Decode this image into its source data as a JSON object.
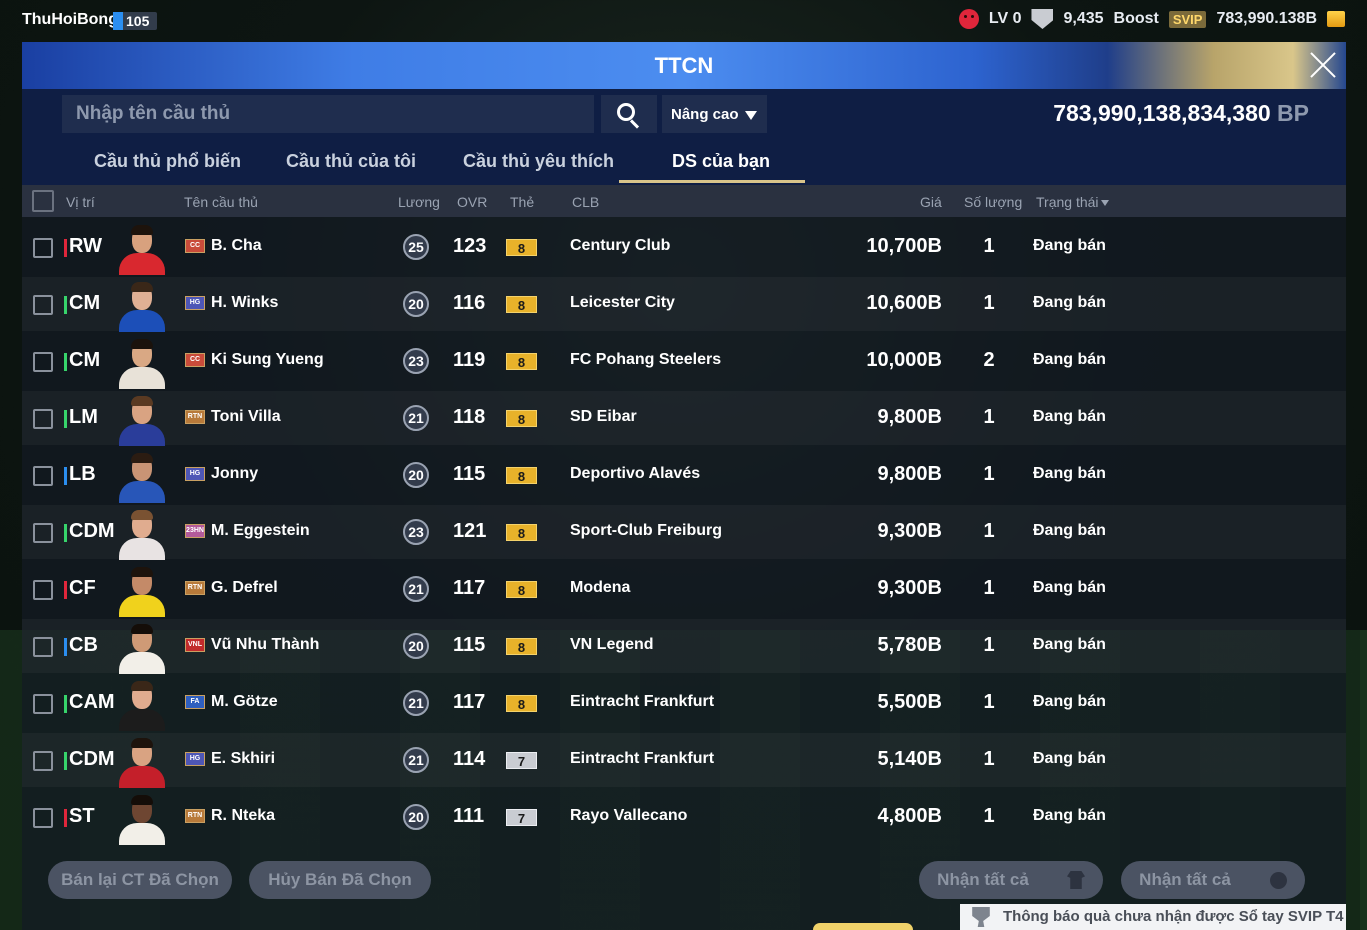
{
  "topbar": {
    "username": "ThuHoiBong",
    "level": "105",
    "lv": "LV 0",
    "coins": "9,435",
    "boost_label": "Boost",
    "svip_label": "SVIP",
    "balance_short": "783,990.138B"
  },
  "window": {
    "title": "TTCN"
  },
  "search": {
    "placeholder": "Nhập tên cầu thủ",
    "advanced_label": "Nâng cao",
    "balance": "783,990,138,834,380",
    "balance_unit": "BP"
  },
  "tabs": [
    {
      "label": "Cầu thủ phổ biến"
    },
    {
      "label": "Cầu thủ của tôi"
    },
    {
      "label": "Cầu thủ yêu thích"
    },
    {
      "label": "DS của bạn"
    }
  ],
  "columns": {
    "position": "Vị trí",
    "name": "Tên cầu thủ",
    "wage": "Lương",
    "ovr": "OVR",
    "card": "Thẻ",
    "club": "CLB",
    "price": "Giá",
    "quantity": "Số lượng",
    "status": "Trạng thái"
  },
  "colors": {
    "pos_attacker": "#e0263b",
    "pos_midfielder": "#37d46b",
    "pos_defender": "#2b8ef0",
    "tab_underline": "#d9c48a",
    "card_gold": "#e8b22a"
  },
  "players": [
    {
      "pos": "RW",
      "pos_color": "#e0263b",
      "season": "CC",
      "season_color": "#c94b3a",
      "name": "B. Cha",
      "wage": "25",
      "ovr": "123",
      "card": "8",
      "card_type": "gold",
      "club": "Century Club",
      "price": "10,700B",
      "qty": "1",
      "status": "Đang bán",
      "shirt": "#d9282f",
      "skin": "#d8a17e",
      "hair": "#1d130c"
    },
    {
      "pos": "CM",
      "pos_color": "#37d46b",
      "season": "HG",
      "season_color": "#4e56b6",
      "name": "H. Winks",
      "wage": "20",
      "ovr": "116",
      "card": "8",
      "card_type": "gold",
      "club": "Leicester City",
      "price": "10,600B",
      "qty": "1",
      "status": "Đang bán",
      "shirt": "#1c4fb8",
      "skin": "#e0b094",
      "hair": "#3a2718"
    },
    {
      "pos": "CM",
      "pos_color": "#37d46b",
      "season": "CC",
      "season_color": "#c94b3a",
      "name": "Ki Sung Yueng",
      "wage": "23",
      "ovr": "119",
      "card": "8",
      "card_type": "gold",
      "club": "FC Pohang Steelers",
      "price": "10,000B",
      "qty": "2",
      "status": "Đang bán",
      "shirt": "#e8e2d8",
      "skin": "#d9a884",
      "hair": "#1a120c"
    },
    {
      "pos": "LM",
      "pos_color": "#37d46b",
      "season": "RTN",
      "season_color": "#b87a3a",
      "name": "Toni Villa",
      "wage": "21",
      "ovr": "118",
      "card": "8",
      "card_type": "gold",
      "club": "SD Eibar",
      "price": "9,800B",
      "qty": "1",
      "status": "Đang bán",
      "shirt": "#2a3d9a",
      "skin": "#d9a382",
      "hair": "#5a3a22"
    },
    {
      "pos": "LB",
      "pos_color": "#2b8ef0",
      "season": "HG",
      "season_color": "#4e56b6",
      "name": "Jonny",
      "wage": "20",
      "ovr": "115",
      "card": "8",
      "card_type": "gold",
      "club": "Deportivo Alavés",
      "price": "9,800B",
      "qty": "1",
      "status": "Đang bán",
      "shirt": "#2856b8",
      "skin": "#c99475",
      "hair": "#2b1c12"
    },
    {
      "pos": "CDM",
      "pos_color": "#37d46b",
      "season": "23HN",
      "season_color": "#b35a9a",
      "name": "M. Eggestein",
      "wage": "23",
      "ovr": "121",
      "card": "8",
      "card_type": "gold",
      "club": "Sport-Club Freiburg",
      "price": "9,300B",
      "qty": "1",
      "status": "Đang bán",
      "shirt": "#e8e3e3",
      "skin": "#e0ac8f",
      "hair": "#7a5232"
    },
    {
      "pos": "CF",
      "pos_color": "#e0263b",
      "season": "RTN",
      "season_color": "#b87a3a",
      "name": "G. Defrel",
      "wage": "21",
      "ovr": "117",
      "card": "8",
      "card_type": "gold",
      "club": "Modena",
      "price": "9,300B",
      "qty": "1",
      "status": "Đang bán",
      "shirt": "#f0d21c",
      "skin": "#c48a68",
      "hair": "#1d130c"
    },
    {
      "pos": "CB",
      "pos_color": "#2b8ef0",
      "season": "VNL",
      "season_color": "#c22b2b",
      "name": "Vũ Nhu Thành",
      "wage": "20",
      "ovr": "115",
      "card": "8",
      "card_type": "gold",
      "club": "VN Legend",
      "price": "5,780B",
      "qty": "1",
      "status": "Đang bán",
      "shirt": "#f2efe8",
      "skin": "#cf9a76",
      "hair": "#140d08"
    },
    {
      "pos": "CAM",
      "pos_color": "#37d46b",
      "season": "FA",
      "season_color": "#2f5fbf",
      "name": "M. Götze",
      "wage": "21",
      "ovr": "117",
      "card": "8",
      "card_type": "gold",
      "club": "Eintracht Frankfurt",
      "price": "5,500B",
      "qty": "1",
      "status": "Đang bán",
      "shirt": "#1c1c1c",
      "skin": "#e0ac8f",
      "hair": "#3a2718"
    },
    {
      "pos": "CDM",
      "pos_color": "#37d46b",
      "season": "HG",
      "season_color": "#4e56b6",
      "name": "E. Skhiri",
      "wage": "21",
      "ovr": "114",
      "card": "7",
      "card_type": "silver",
      "club": "Eintracht Frankfurt",
      "price": "5,140B",
      "qty": "1",
      "status": "Đang bán",
      "shirt": "#c41f2a",
      "skin": "#d9a382",
      "hair": "#1d130c"
    },
    {
      "pos": "ST",
      "pos_color": "#e0263b",
      "season": "RTN",
      "season_color": "#b87a3a",
      "name": "R. Nteka",
      "wage": "20",
      "ovr": "111",
      "card": "7",
      "card_type": "silver",
      "club": "Rayo Vallecano",
      "price": "4,800B",
      "qty": "1",
      "status": "Đang bán",
      "shirt": "#f2efe8",
      "skin": "#6e4632",
      "hair": "#140d08"
    }
  ],
  "footer": {
    "resell_label": "Bán lại CT Đã Chọn",
    "cancel_label": "Hủy Bán Đã Chọn",
    "claim_all_label_1": "Nhận tất cả",
    "claim_all_label_2": "Nhận tất cả",
    "notice": "Thông báo quà chưa nhận được Sổ tay SVIP T4"
  }
}
